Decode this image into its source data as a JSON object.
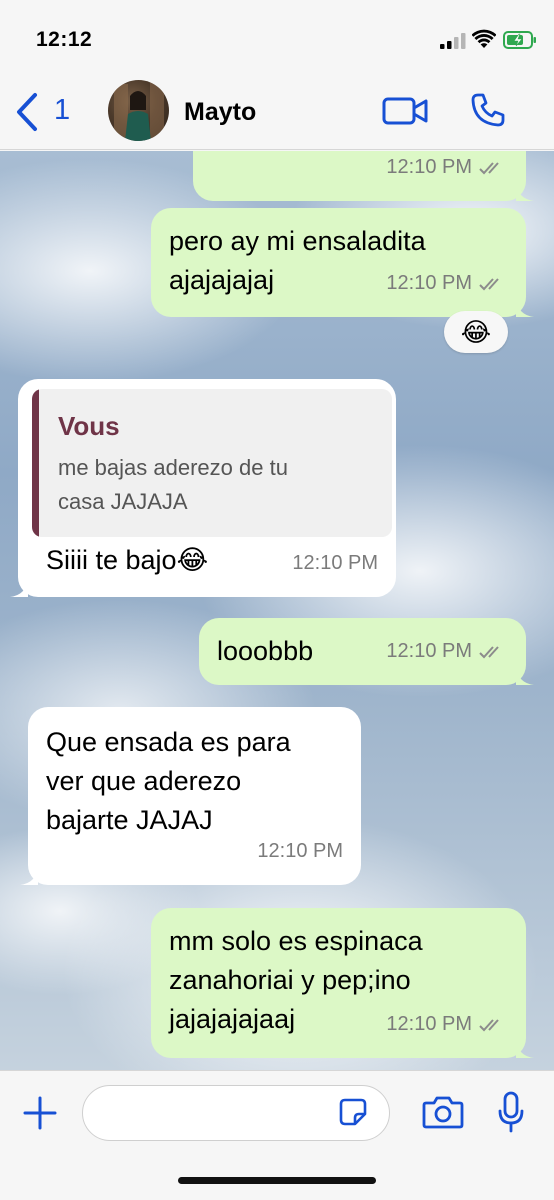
{
  "status_bar": {
    "time": "12:12"
  },
  "header": {
    "back_count": "1",
    "contact_name": "Mayto"
  },
  "messages": [
    {
      "direction": "out",
      "text": "",
      "time": "12:10 PM",
      "read": true
    },
    {
      "direction": "out",
      "text": "pero ay mi ensaladita\najajajajaj",
      "time": "12:10 PM",
      "read": true,
      "reaction": "😂"
    },
    {
      "direction": "in",
      "quote_author": "Vous",
      "quote_text": "me bajas aderezo de tu\ncasa JAJAJA",
      "text": "Siiii te bajo😂",
      "time": "12:10 PM"
    },
    {
      "direction": "out",
      "text": "looobbb",
      "time": "12:10 PM",
      "read": true
    },
    {
      "direction": "in",
      "text": "Que ensada es para\nver que aderezo\nbajarte JAJAJ",
      "time": "12:10 PM"
    },
    {
      "direction": "out",
      "text": "mm solo es espinaca\nzanahoriai y pep;ino\njajajajajaaj",
      "time": "12:10 PM",
      "read": true
    }
  ],
  "colors": {
    "accent": "#1750d4",
    "outgoing_bubble": "#dcf8c6",
    "incoming_bubble": "#ffffff",
    "quote_author": "#6f3447"
  },
  "icons": [
    "back-chevron-icon",
    "video-call-icon",
    "phone-call-icon",
    "plus-icon",
    "sticker-icon",
    "camera-icon",
    "microphone-icon",
    "read-ticks-icon"
  ]
}
